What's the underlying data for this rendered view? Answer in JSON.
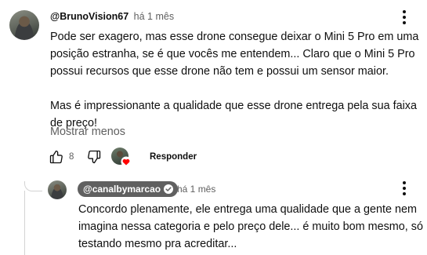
{
  "comment": {
    "author": "@BrunoVision67",
    "time": "há 1 mês",
    "text": "Pode ser exagero, mas esse drone consegue deixar o Mini 5 Pro em uma posição estranha, se é que vocês me entendem... Claro que o Mini 5 Pro possui recursos que esse drone não tem e possui um sensor maior.\n\nMas é impressionante a qualidade que esse drone entrega pela sua faixa de preço!",
    "show_less_label": "Mostrar menos",
    "like_count": "8",
    "reply_label": "Responder",
    "icons": {
      "menu": "more-vert-icon",
      "like": "thumb-up-icon",
      "dislike": "thumb-down-icon",
      "creator_heart": "creator-heart-icon"
    }
  },
  "reply": {
    "author": "@canalbymarcao",
    "time": "há 1 mês",
    "text": "Concordo plenamente, ele entrega uma qualidade que a gente nem imagina nessa categoria e pelo preço dele... é muito bom mesmo, só testando mesmo pra acreditar...",
    "icons": {
      "menu": "more-vert-icon",
      "verified": "verified-check-icon"
    }
  },
  "colors": {
    "text_primary": "#0f0f0f",
    "text_secondary": "#606060",
    "chip_background": "#606060",
    "heart_red": "#ff0000"
  }
}
